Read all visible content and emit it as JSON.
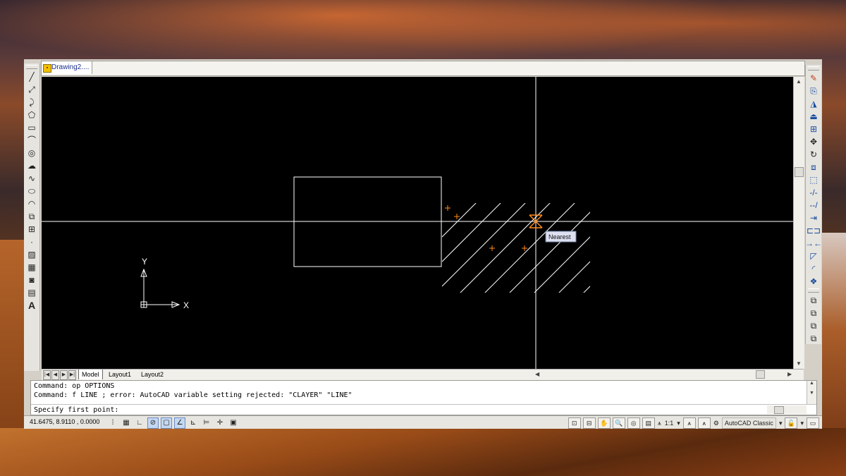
{
  "document": {
    "tab_title": "Drawing2...."
  },
  "layout_tabs": [
    "Model",
    "Layout1",
    "Layout2"
  ],
  "canvas": {
    "ucs_y_label": "Y",
    "ucs_x_label": "X",
    "snap_tooltip": "Nearest",
    "colors": {
      "background": "#000000",
      "geometry": "#ffffff",
      "snap_marker": "#ff8c1a",
      "tooltip_bg": "#dde0f0"
    }
  },
  "command": {
    "history": [
      "Command: op OPTIONS",
      "Command: f LINE ; error: AutoCAD variable setting rejected: \"CLAYER\" \"LINE\""
    ],
    "prompt": "Specify first point:"
  },
  "status": {
    "coordinates": "41.6475, 8.9110 , 0.0000",
    "annotation_scale": "1:1",
    "workspace": "AutoCAD Classic"
  },
  "icons": {
    "left_toolbar": [
      "line-icon",
      "construction-line-icon",
      "polyline-icon",
      "polygon-icon",
      "rectangle-icon",
      "arc-icon",
      "circle-icon",
      "revision-cloud-icon",
      "spline-icon",
      "ellipse-icon",
      "ellipse-arc-icon",
      "insert-block-icon",
      "make-block-icon",
      "point-icon",
      "hatch-icon",
      "gradient-icon",
      "region-icon",
      "table-icon",
      "multiline-text-icon"
    ],
    "right_toolbar": [
      "erase-icon",
      "copy-icon",
      "mirror-icon",
      "offset-icon",
      "array-icon",
      "move-icon",
      "rotate-icon",
      "scale-icon",
      "stretch-icon",
      "trim-icon",
      "extend-icon",
      "break-at-point-icon",
      "break-icon",
      "join-icon",
      "chamfer-icon",
      "fillet-icon",
      "explode-icon",
      "draw-order-front-icon",
      "draw-order-back-icon",
      "bring-above-icon",
      "send-under-icon"
    ],
    "status_toggles": [
      "snap-icon",
      "grid-icon",
      "ortho-icon",
      "polar-icon",
      "osnap-icon",
      "otrack-icon",
      "ducs-icon",
      "dyn-icon",
      "lineweight-icon",
      "quick-properties-icon"
    ]
  }
}
